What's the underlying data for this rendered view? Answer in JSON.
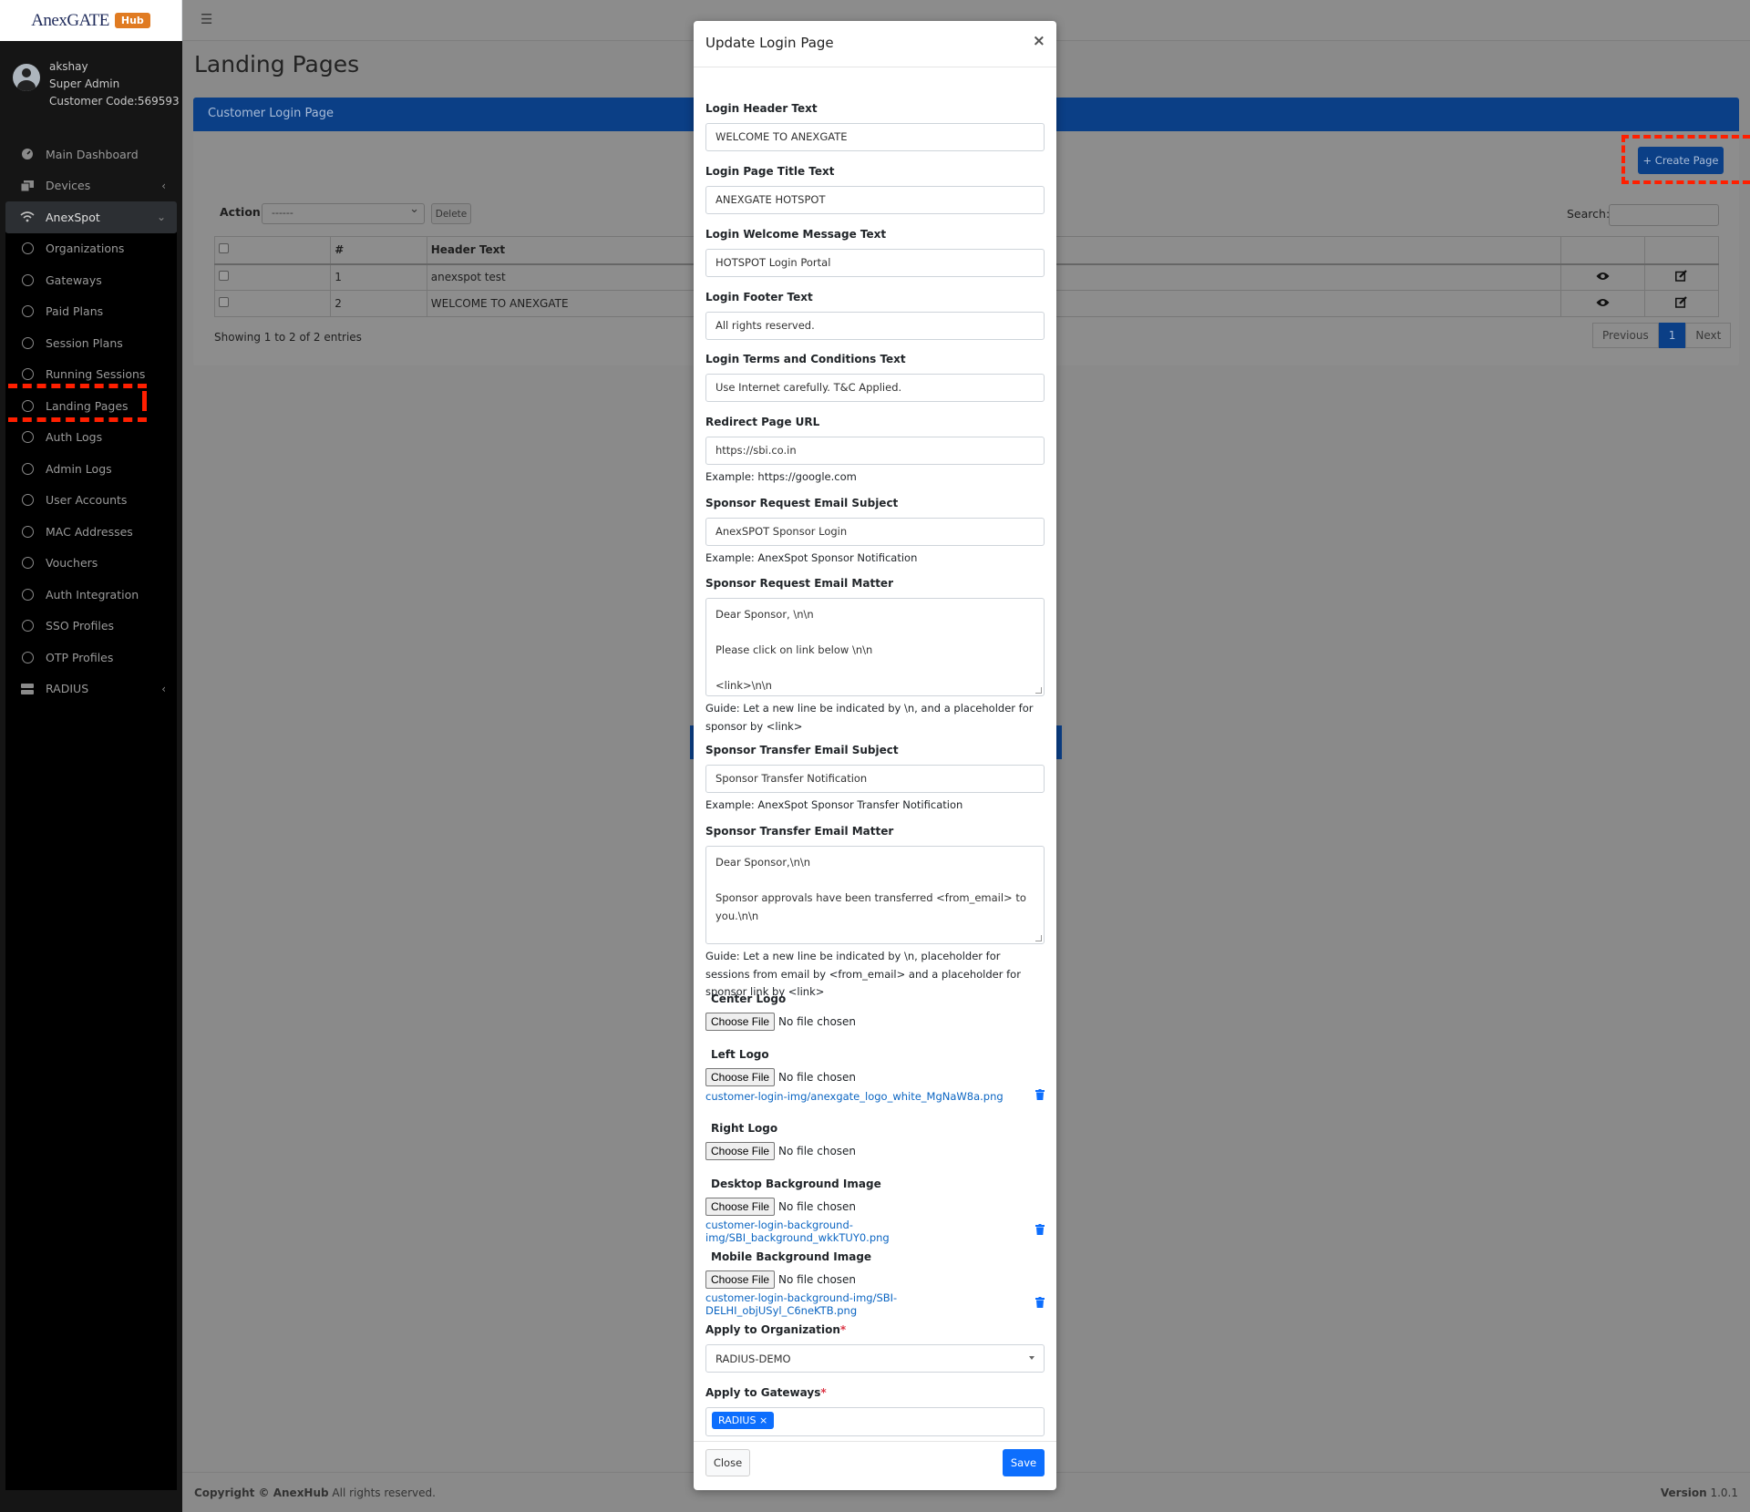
{
  "brand": {
    "name": "AnexGATE",
    "badge": "Hub"
  },
  "user": {
    "name": "akshay",
    "role": "Super Admin",
    "customer_code": "Customer Code:569593"
  },
  "sidebar": {
    "items": [
      {
        "label": "Main Dashboard",
        "icon": "dashboard-icon"
      },
      {
        "label": "Devices",
        "icon": "devices-icon"
      },
      {
        "label": "AnexSpot",
        "icon": "wifi-icon"
      },
      {
        "label": "Organizations"
      },
      {
        "label": "Gateways"
      },
      {
        "label": "Paid Plans"
      },
      {
        "label": "Session Plans"
      },
      {
        "label": "Running Sessions"
      },
      {
        "label": "Landing Pages"
      },
      {
        "label": "Auth Logs"
      },
      {
        "label": "Admin Logs"
      },
      {
        "label": "User Accounts"
      },
      {
        "label": "MAC Addresses"
      },
      {
        "label": "Vouchers"
      },
      {
        "label": "Auth Integration"
      },
      {
        "label": "SSO Profiles"
      },
      {
        "label": "OTP Profiles"
      },
      {
        "label": "RADIUS",
        "icon": "server-icon"
      }
    ]
  },
  "page": {
    "title": "Landing Pages",
    "card_title": "Customer Login Page",
    "create_button": "+ Create Page",
    "action_label": "Action:",
    "action_selected": "------",
    "delete_button": "Delete",
    "search_label": "Search:",
    "table": {
      "headers": [
        "#",
        "Header Text"
      ],
      "rows": [
        {
          "num": "1",
          "header_text": "anexspot test"
        },
        {
          "num": "2",
          "header_text": "WELCOME TO ANEXGATE"
        }
      ]
    },
    "showing": "Showing 1 to 2 of 2 entries",
    "pager": {
      "previous": "Previous",
      "current": "1",
      "next": "Next"
    }
  },
  "footer": {
    "copyright_bold": "Copyright © AnexHub",
    "copyright_rest": " All rights reserved.",
    "version_label": "Version",
    "version_value": "1.0.1"
  },
  "modal": {
    "title": "Update Login Page",
    "close_symbol": "×",
    "fields": {
      "header_text": {
        "label": "Login Header Text",
        "value": "WELCOME TO ANEXGATE"
      },
      "title_text": {
        "label": "Login Page Title Text",
        "value": "ANEXGATE HOTSPOT"
      },
      "welcome_text": {
        "label": "Login Welcome Message Text",
        "value": "HOTSPOT Login Portal"
      },
      "footer_text": {
        "label": "Login Footer Text",
        "value": "All rights reserved."
      },
      "terms_text": {
        "label": "Login Terms and Conditions Text",
        "value": "Use Internet carefully. T&C Applied."
      },
      "redirect_url": {
        "label": "Redirect Page URL",
        "value": "https://sbi.co.in",
        "help": "Example: https://google.com"
      },
      "sponsor_subject": {
        "label": "Sponsor Request Email Subject",
        "value": "AnexSPOT Sponsor Login",
        "help": "Example: AnexSpot Sponsor Notification"
      },
      "sponsor_matter": {
        "label": "Sponsor Request Email Matter",
        "line1": " Dear Sponsor, \\n\\n",
        "line2": "Please click on link below \\n\\n",
        "line3": "<link>\\n\\n",
        "help": "Guide: Let a new line be indicated by \\n, and a placeholder for sponsor by <link>"
      },
      "transfer_subject": {
        "label": "Sponsor Transfer Email Subject",
        "value": "Sponsor Transfer Notification",
        "help": "Example: AnexSpot Sponsor Transfer Notification"
      },
      "transfer_matter": {
        "label": "Sponsor Transfer Email Matter",
        "line1": " Dear Sponsor,\\n\\n",
        "line2": "Sponsor approvals have been transferred <from_email> to you.\\n\\n",
        "help": "Guide: Let a new line be indicated by \\n, placeholder for sessions from email by <from_email> and a placeholder for sponsor link by <link>"
      },
      "choose_file": "Choose File",
      "no_file": "No file chosen",
      "center_logo": {
        "label": "Center Logo"
      },
      "left_logo": {
        "label": "Left Logo",
        "file": "customer-login-img/anexgate_logo_white_MgNaW8a.png"
      },
      "right_logo": {
        "label": "Right Logo"
      },
      "desktop_bg": {
        "label": "Desktop Background Image",
        "file": "customer-login-background-img/SBI_background_wkkTUY0.png"
      },
      "mobile_bg": {
        "label": "Mobile Background Image",
        "file": "customer-login-background-img/SBI-DELHI_objUSyl_C6neKTB.png"
      },
      "organization": {
        "label": "Apply to Organization",
        "required": "*",
        "value": "RADIUS-DEMO"
      },
      "gateways": {
        "label": "Apply to Gateways",
        "required": "*",
        "tag": "RADIUS",
        "tag_remove": "×"
      }
    },
    "close_button": "Close",
    "save_button": "Save"
  }
}
